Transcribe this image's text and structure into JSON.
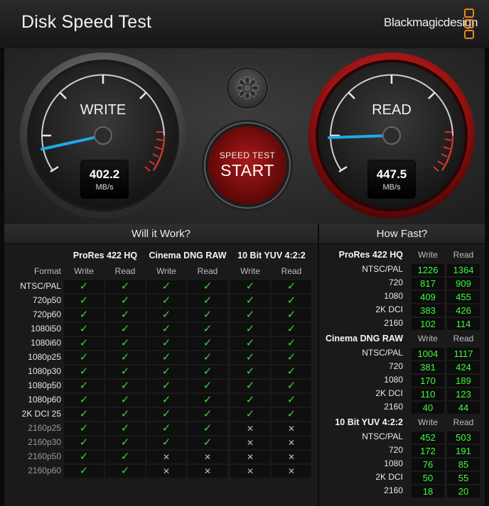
{
  "window": {
    "title": "Disk Speed Test",
    "brand": "Blackmagicdesign"
  },
  "colors": {
    "accent_green": "#3bff3b",
    "accent_red": "#c62020",
    "needle_blue": "#1fa9e6",
    "logo_orange": "#e48a1f"
  },
  "gauges": {
    "write": {
      "label": "WRITE",
      "value": "402.2",
      "unit": "MB/s",
      "needle_fraction": 0.08
    },
    "read": {
      "label": "READ",
      "value": "447.5",
      "unit": "MB/s",
      "needle_fraction": 0.12
    }
  },
  "start_button": {
    "small": "SPEED TEST",
    "big": "START"
  },
  "settings_icon": "gear-icon",
  "will_it_work": {
    "title": "Will it Work?",
    "format_header": "Format",
    "groups": [
      "ProRes 422 HQ",
      "Cinema DNG RAW",
      "10 Bit YUV 4:2:2"
    ],
    "sub_headers": [
      "Write",
      "Read",
      "Write",
      "Read",
      "Write",
      "Read"
    ],
    "rows": [
      {
        "format": "NTSC/PAL",
        "checks": [
          1,
          1,
          1,
          1,
          1,
          1
        ]
      },
      {
        "format": "720p50",
        "checks": [
          1,
          1,
          1,
          1,
          1,
          1
        ]
      },
      {
        "format": "720p60",
        "checks": [
          1,
          1,
          1,
          1,
          1,
          1
        ]
      },
      {
        "format": "1080i50",
        "checks": [
          1,
          1,
          1,
          1,
          1,
          1
        ]
      },
      {
        "format": "1080i60",
        "checks": [
          1,
          1,
          1,
          1,
          1,
          1
        ]
      },
      {
        "format": "1080p25",
        "checks": [
          1,
          1,
          1,
          1,
          1,
          1
        ]
      },
      {
        "format": "1080p30",
        "checks": [
          1,
          1,
          1,
          1,
          1,
          1
        ]
      },
      {
        "format": "1080p50",
        "checks": [
          1,
          1,
          1,
          1,
          1,
          1
        ]
      },
      {
        "format": "1080p60",
        "checks": [
          1,
          1,
          1,
          1,
          1,
          1
        ]
      },
      {
        "format": "2K DCI 25",
        "checks": [
          1,
          1,
          1,
          1,
          1,
          1
        ]
      },
      {
        "format": "2160p25",
        "checks": [
          1,
          1,
          1,
          1,
          0,
          0
        ]
      },
      {
        "format": "2160p30",
        "checks": [
          1,
          1,
          1,
          1,
          0,
          0
        ]
      },
      {
        "format": "2160p50",
        "checks": [
          1,
          1,
          0,
          0,
          0,
          0
        ]
      },
      {
        "format": "2160p60",
        "checks": [
          1,
          1,
          0,
          0,
          0,
          0
        ]
      }
    ],
    "check_glyph": "✓",
    "cross_glyph": "✕"
  },
  "how_fast": {
    "title": "How Fast?",
    "groups": [
      {
        "name": "ProRes 422 HQ",
        "write": "Write",
        "read": "Read",
        "rows": [
          {
            "format": "NTSC/PAL",
            "write": "1226",
            "read": "1364"
          },
          {
            "format": "720",
            "write": "817",
            "read": "909"
          },
          {
            "format": "1080",
            "write": "409",
            "read": "455"
          },
          {
            "format": "2K DCI",
            "write": "383",
            "read": "426"
          },
          {
            "format": "2160",
            "write": "102",
            "read": "114"
          }
        ]
      },
      {
        "name": "Cinema DNG RAW",
        "write": "Write",
        "read": "Read",
        "rows": [
          {
            "format": "NTSC/PAL",
            "write": "1004",
            "read": "1117"
          },
          {
            "format": "720",
            "write": "381",
            "read": "424"
          },
          {
            "format": "1080",
            "write": "170",
            "read": "189"
          },
          {
            "format": "2K DCI",
            "write": "110",
            "read": "123"
          },
          {
            "format": "2160",
            "write": "40",
            "read": "44"
          }
        ]
      },
      {
        "name": "10 Bit YUV 4:2:2",
        "write": "Write",
        "read": "Read",
        "rows": [
          {
            "format": "NTSC/PAL",
            "write": "452",
            "read": "503"
          },
          {
            "format": "720",
            "write": "172",
            "read": "191"
          },
          {
            "format": "1080",
            "write": "76",
            "read": "85"
          },
          {
            "format": "2K DCI",
            "write": "50",
            "read": "55"
          },
          {
            "format": "2160",
            "write": "18",
            "read": "20"
          }
        ]
      }
    ]
  }
}
